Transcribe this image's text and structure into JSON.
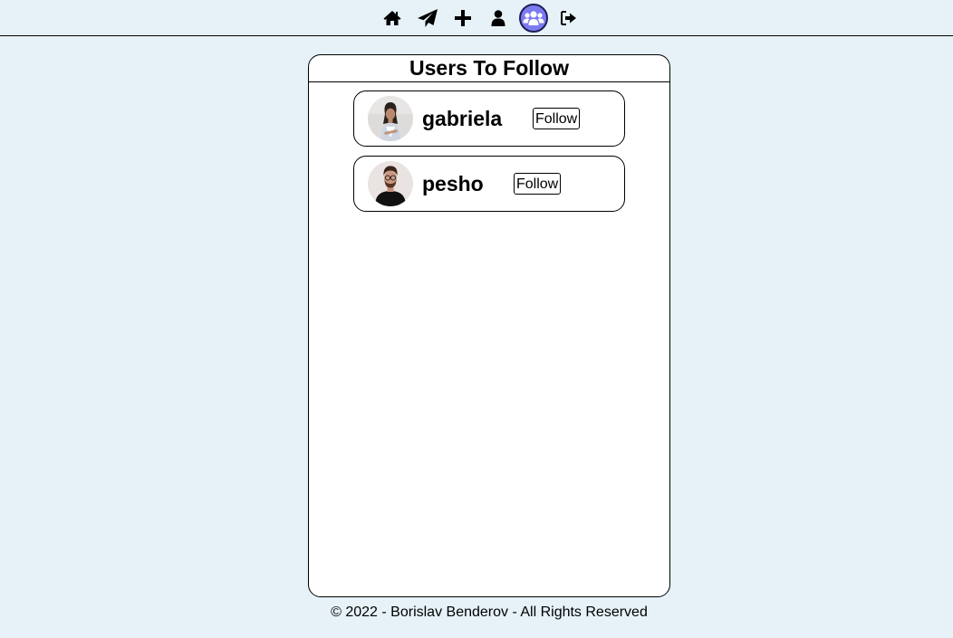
{
  "nav": {
    "items": [
      {
        "icon": "home-icon",
        "active": false
      },
      {
        "icon": "paper-plane-icon",
        "active": false
      },
      {
        "icon": "plus-icon",
        "active": false
      },
      {
        "icon": "user-icon",
        "active": false
      },
      {
        "icon": "users-icon",
        "active": true
      },
      {
        "icon": "sign-out-icon",
        "active": false
      }
    ],
    "active_color": "#7b7bf0"
  },
  "panel": {
    "title": "Users To Follow",
    "users": [
      {
        "name": "gabriela",
        "button_label": "Follow"
      },
      {
        "name": "pesho",
        "button_label": "Follow"
      }
    ]
  },
  "footer": {
    "text": "© 2022 - Borislav Benderov - All Rights Reserved"
  },
  "colors": {
    "background": "#e6f2f8",
    "panel": "#ffffff"
  }
}
